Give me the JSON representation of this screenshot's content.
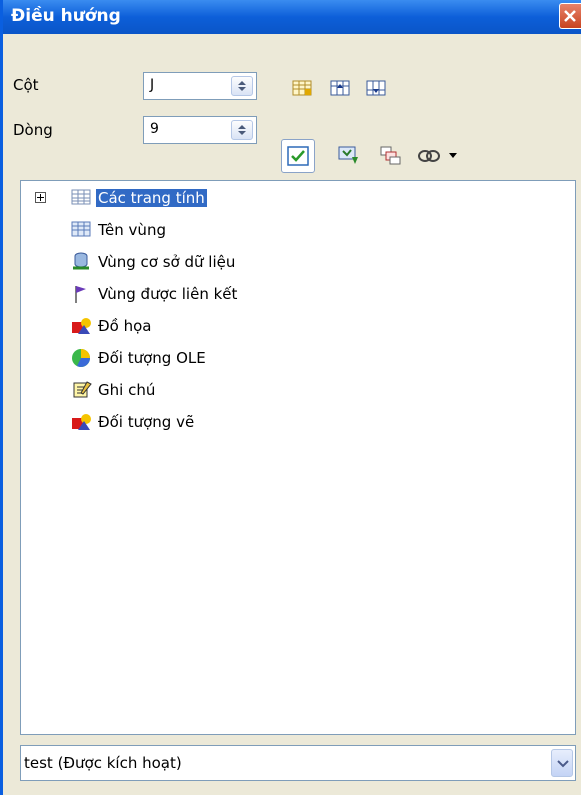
{
  "window": {
    "title": "Điều hướng"
  },
  "fields": {
    "column": {
      "label": "Cột",
      "value": "J"
    },
    "row": {
      "label": "Dòng",
      "value": "9"
    }
  },
  "toolbar": {
    "icons": [
      "data-range-icon",
      "range-start-icon",
      "range-end-icon",
      "content-toggle-icon",
      "drag-mode-icon",
      "scenarios-icon",
      "links-icon",
      "dropdown-arrow-icon"
    ]
  },
  "tree": {
    "items": [
      {
        "label": "Các trang tính",
        "icon": "sheet-icon",
        "selected": true,
        "expandable": true
      },
      {
        "label": "Tên vùng",
        "icon": "range-name-icon"
      },
      {
        "label": "Vùng cơ sở dữ liệu",
        "icon": "database-icon"
      },
      {
        "label": "Vùng được liên kết",
        "icon": "flag-icon"
      },
      {
        "label": "Đồ họa",
        "icon": "graphics-icon"
      },
      {
        "label": "Đối tượng OLE",
        "icon": "ole-object-icon"
      },
      {
        "label": "Ghi chú",
        "icon": "note-icon"
      },
      {
        "label": "Đối tượng vẽ",
        "icon": "drawing-object-icon"
      }
    ]
  },
  "document_select": {
    "value": "test (Được kích hoạt)"
  }
}
